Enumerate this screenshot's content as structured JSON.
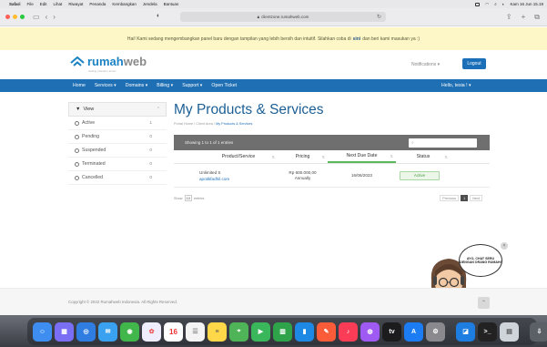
{
  "menubar": {
    "items": [
      "Safari",
      "File",
      "Edit",
      "Lihat",
      "Riwayat",
      "Penanda",
      "Kembangkan",
      "Jendela",
      "Bantuan"
    ],
    "clock": "Kam 16 Jun  15.19"
  },
  "browser": {
    "url": "clientzone.rumahweb.com"
  },
  "announcement": {
    "text": "Hai! Kami sedang mengembangkan panel baru dengan tampilan yang lebih bersih dan intuitif. Silahkan coba di",
    "link": "sini",
    "tail": "dan beri kami masukan ya :)"
  },
  "header": {
    "logo_main": "rumah",
    "logo_suffix": "web",
    "logo_tagline": "hosting | domain | server",
    "notifications": "Notifications ▾",
    "logout": "Logout"
  },
  "nav": {
    "items": [
      "Home",
      "Services ▾",
      "Domains ▾",
      "Billing ▾",
      "Support ▾",
      "Open Ticket"
    ],
    "hello": "Hello, tesia ! ▾"
  },
  "sidebar": {
    "title": "View",
    "items": [
      {
        "label": "Active",
        "count": "1"
      },
      {
        "label": "Pending",
        "count": "0"
      },
      {
        "label": "Suspended",
        "count": "0"
      },
      {
        "label": "Terminated",
        "count": "0"
      },
      {
        "label": "Cancelled",
        "count": "0"
      }
    ]
  },
  "main": {
    "title": "My Products & Services",
    "breadcrumb": {
      "home": "Portal Home",
      "client": "Client Area",
      "current": "My Products & Services"
    },
    "showing": "Showing 1 to 1 of 1 entries",
    "columns": [
      "Product/Service",
      "Pricing",
      "Next Due Date",
      "Status"
    ],
    "row": {
      "product": "Unlimited S",
      "domain": "apotikfadhil.com",
      "price": "Rp 600.000,00",
      "cycle": "Annually",
      "due": "16/06/2023",
      "status": "Active"
    },
    "show_label": "Show",
    "show_value": "10",
    "entries_label": "entries",
    "pager": {
      "prev": "Previous",
      "page": "1",
      "next": "Next"
    }
  },
  "chat": {
    "bubble": "AYO, CHAT SERU DENGAN ORANG RUMAH!"
  },
  "footer": {
    "copyright": "Copyright © 2022 Rumahweb Indonesia. All Rights Reserved."
  },
  "dock": {
    "calendar_day": "16"
  }
}
